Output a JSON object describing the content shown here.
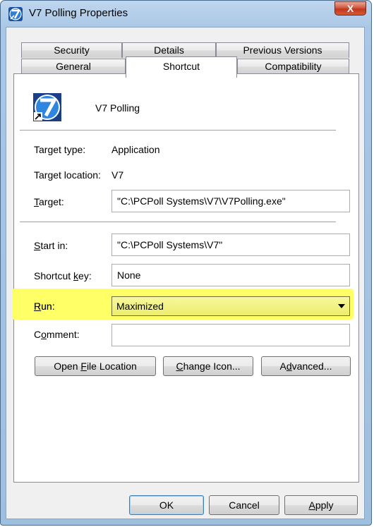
{
  "window": {
    "title": "V7 Polling Properties",
    "close_glyph": "X",
    "icon": "v7-app-icon"
  },
  "tabs": {
    "row1": [
      "Security",
      "Details",
      "Previous Versions"
    ],
    "row2": [
      "General",
      "Shortcut",
      "Compatibility"
    ],
    "active": "Shortcut"
  },
  "shortcut": {
    "name": "V7 Polling",
    "target_type_label": "Target type:",
    "target_type_value": "Application",
    "target_location_label": "Target location:",
    "target_location_value": "V7",
    "target_label": "arget:",
    "target_label_mnemonic": "T",
    "target_value": "\"C:\\PCPoll Systems\\V7\\V7Polling.exe\"",
    "start_in_label_mnemonic": "S",
    "start_in_label": "tart in:",
    "start_in_value": "\"C:\\PCPoll Systems\\V7\"",
    "shortcut_key_label_pre": "Shortcut ",
    "shortcut_key_label_mnemonic": "k",
    "shortcut_key_label_post": "ey:",
    "shortcut_key_value": "None",
    "run_label_mnemonic": "R",
    "run_label": "un:",
    "run_value": "Maximized",
    "comment_label_pre": "C",
    "comment_label_mnemonic": "o",
    "comment_label_post": "mment:",
    "comment_value": ""
  },
  "buttons": {
    "open_file_location_pre": "Open ",
    "open_file_location_mnemonic": "F",
    "open_file_location_post": "ile Location",
    "change_icon_mnemonic": "C",
    "change_icon_post": "hange Icon...",
    "advanced_pre": "A",
    "advanced_mnemonic": "d",
    "advanced_post": "vanced...",
    "ok": "OK",
    "cancel": "Cancel",
    "apply_mnemonic": "A",
    "apply_post": "pply"
  },
  "colors": {
    "highlight": "#ffff66",
    "title_bar": "#a9c7e6",
    "close_button": "#c0381c"
  }
}
